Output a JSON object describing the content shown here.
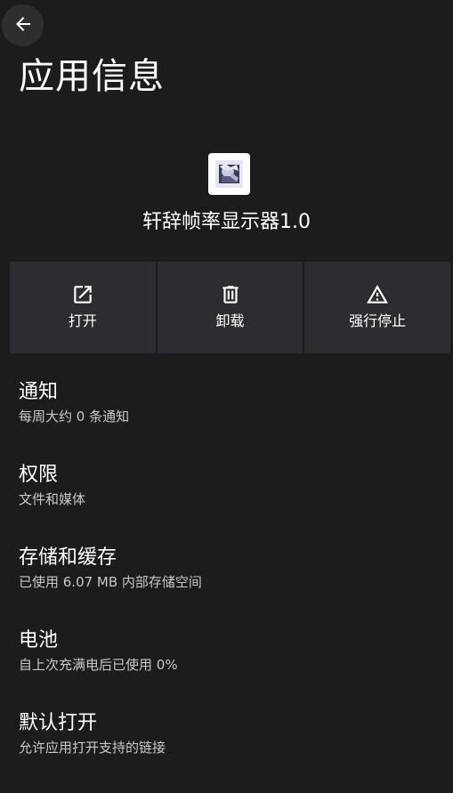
{
  "header": {
    "back_icon": "arrow-left-icon",
    "title": "应用信息"
  },
  "app": {
    "icon": "app-icon",
    "name": "轩辞帧率显示器1.0"
  },
  "actions": [
    {
      "label": "打开",
      "icon": "open-external-icon"
    },
    {
      "label": "卸载",
      "icon": "trash-icon"
    },
    {
      "label": "强行停止",
      "icon": "warning-icon"
    }
  ],
  "settings": [
    {
      "title": "通知",
      "summary": "每周大约 0 条通知"
    },
    {
      "title": "权限",
      "summary": "文件和媒体"
    },
    {
      "title": "存储和缓存",
      "summary": "已使用 6.07 MB 内部存储空间"
    },
    {
      "title": "电池",
      "summary": "自上次充满电后已使用 0%"
    },
    {
      "title": "默认打开",
      "summary": "允许应用打开支持的链接"
    }
  ],
  "colors": {
    "background": "#1c1c1c",
    "action_background": "#2c2d30",
    "summary_text": "#c8c8c8"
  }
}
